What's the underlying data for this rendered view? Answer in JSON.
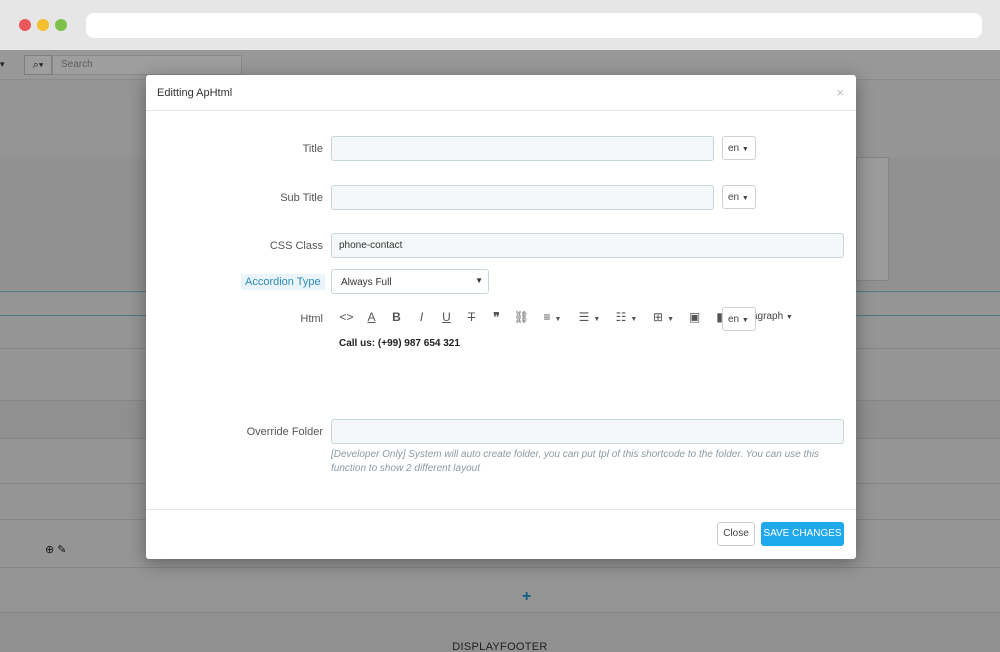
{
  "background": {
    "search_placeholder": "Search",
    "footer_label": "DISPLAYFOOTER"
  },
  "modal": {
    "title": "Editting ApHtml",
    "close_glyph": "×",
    "fields": {
      "title_label": "Title",
      "subtitle_label": "Sub Title",
      "css_class_label": "CSS Class",
      "css_class_value": "phone-contact",
      "accordion_label": "Accordion Type",
      "accordion_value": "Always Full",
      "html_label": "Html",
      "html_content": "Call us: (+99) 987 654 321",
      "override_label": "Override Folder",
      "override_help": "[Developer Only] System will auto create folder, you can put tpl of this shortcode to the folder. You can use this function to show 2 different layout"
    },
    "lang": "en",
    "editor_toolbar": {
      "paragraph_label": "agraph"
    },
    "buttons": {
      "close": "Close",
      "save": "SAVE CHANGES"
    }
  },
  "icons": [
    "code-icon",
    "font-color-icon",
    "bold-icon",
    "italic-icon",
    "underline-icon",
    "strikethrough-icon",
    "quote-icon",
    "link-icon",
    "align-icon",
    "bullet-list-icon",
    "numbered-list-icon",
    "table-icon",
    "image-icon",
    "video-icon"
  ]
}
